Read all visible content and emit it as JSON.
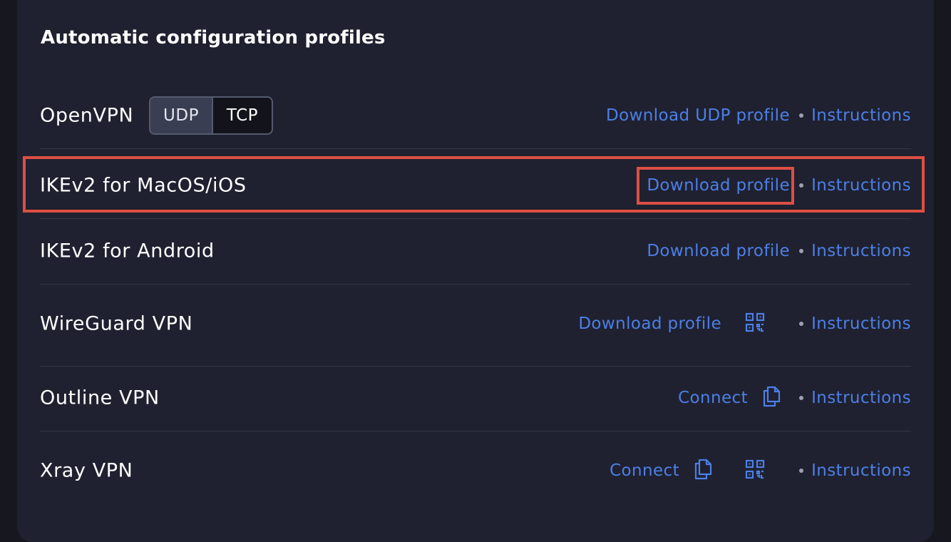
{
  "section": {
    "title": "Automatic configuration profiles"
  },
  "rows": [
    {
      "name": "OpenVPN",
      "protocols": [
        "UDP",
        "TCP"
      ],
      "selected_protocol": "UDP",
      "download_label": "Download UDP profile",
      "instructions_label": "Instructions"
    },
    {
      "name": "IKEv2 for MacOS/iOS",
      "download_label": "Download profile",
      "instructions_label": "Instructions",
      "highlighted": true
    },
    {
      "name": "IKEv2 for Android",
      "download_label": "Download profile",
      "instructions_label": "Instructions"
    },
    {
      "name": "WireGuard VPN",
      "download_label": "Download profile",
      "icons": [
        "qr-code-icon"
      ],
      "instructions_label": "Instructions"
    },
    {
      "name": "Outline VPN",
      "connect_label": "Connect",
      "icons": [
        "copy-icon"
      ],
      "instructions_label": "Instructions"
    },
    {
      "name": "Xray VPN",
      "connect_label": "Connect",
      "icons": [
        "copy-icon",
        "qr-code-icon"
      ],
      "instructions_label": "Instructions"
    }
  ],
  "colors": {
    "background": "#16171f",
    "card": "#1f2130",
    "link": "#4d7fe6",
    "highlight": "#dd4f43",
    "text": "#ffffff"
  }
}
